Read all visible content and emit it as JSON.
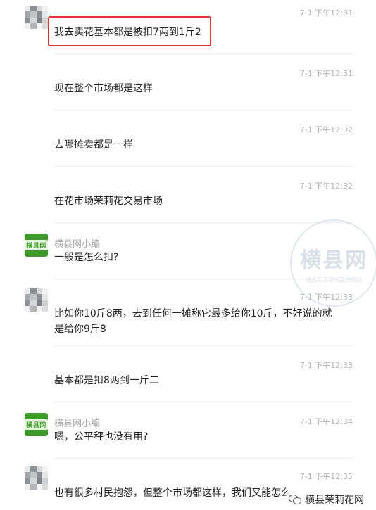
{
  "messages": [
    {
      "type": "user",
      "time": "7-1 下午12:31",
      "text": "我去卖花基本都是被扣7两到1斤2",
      "highlighted": true
    },
    {
      "type": "user",
      "time": "7-1 下午12:31",
      "text": "现在整个市场都是这样"
    },
    {
      "type": "user",
      "time": "7-1 下午12:32",
      "text": "去哪摊卖都是一样"
    },
    {
      "type": "user",
      "time": "7-1 下午12:32",
      "text": "在花市场茉莉花交易市场"
    },
    {
      "type": "editor",
      "sender": "横县网小编",
      "text": "一般是怎么扣?"
    },
    {
      "type": "user",
      "time": "7-1 下午12:33",
      "text": "比如你10斤8两，去到任何一摊称它最多给你10斤，不好说的就是给你9斤8"
    },
    {
      "type": "user",
      "time": "7-1 下午12:33",
      "text": "基本都是扣8两到一斤二"
    },
    {
      "type": "editor",
      "sender": "横县网小编",
      "time": "7-1 下午12:34",
      "text": "嗯，公平秤也没有用?"
    },
    {
      "type": "user",
      "time": "7-1 下午12:35",
      "text": "也有很多村民抱怨，但整个市场都这样，我们又能怎么"
    }
  ],
  "editor_avatar_label": "横县网",
  "watermark": {
    "big": "横县网",
    "small": "横县生活资讯品牌网站"
  },
  "bottom_brand": "横县茉莉花网",
  "colors": {
    "highlight": "#e03434",
    "brand_green": "#3f9a2c",
    "time": "#b1b1b1"
  }
}
